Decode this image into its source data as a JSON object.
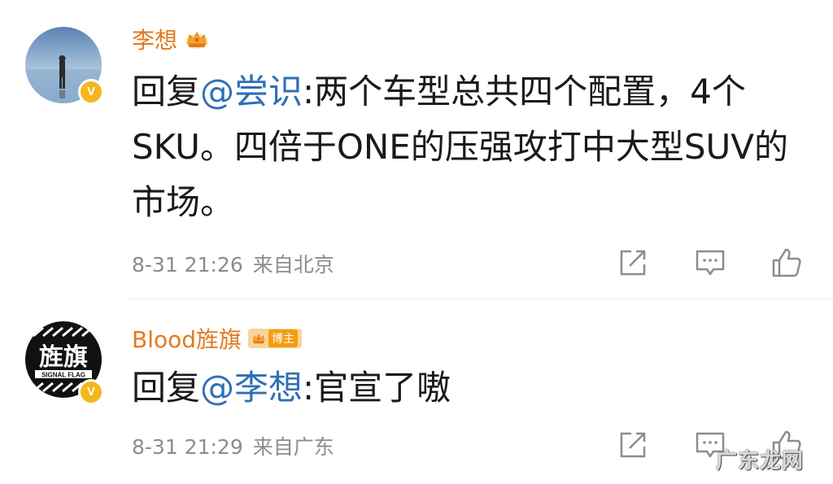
{
  "posts": [
    {
      "author": "李想",
      "verified": "V",
      "content_prefix": "回复",
      "mention": "@尝识",
      "content_rest": ":两个车型总共四个配置，4个SKU。四倍于ONE的压强攻打中大型SUV的市场。",
      "time": "8-31 21:26",
      "location": "来自北京"
    },
    {
      "author": "Blood旌旗",
      "verified": "V",
      "tag": "博主",
      "avatar_text": "旌旗",
      "avatar_subtext": "SIGNAL FLAG",
      "content_prefix": "回复",
      "mention": "@李想",
      "content_rest": ":官宣了嗷",
      "time": "8-31 21:29",
      "location": "来自广东"
    }
  ],
  "icons": [
    "share-icon",
    "comment-icon",
    "like-icon",
    "crown-icon"
  ],
  "colors": {
    "name": "#e07a1f",
    "mention": "#2f6fb8",
    "meta": "#8c8c8c",
    "badge": "#f5b71d"
  },
  "watermark": "广东龙网"
}
